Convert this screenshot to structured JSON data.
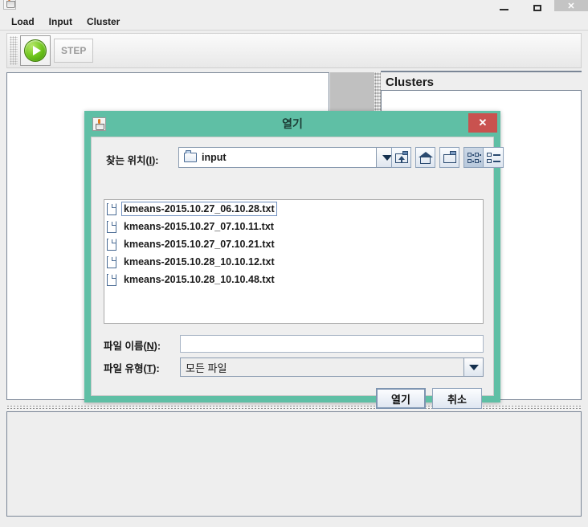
{
  "window": {
    "title": "",
    "controls": {
      "minimize": "–",
      "maximize": "☐",
      "close": "✕"
    },
    "app_icon": "java-coffee-cup-icon"
  },
  "menubar": {
    "items": [
      {
        "label": "Load"
      },
      {
        "label": "Input"
      },
      {
        "label": "Cluster"
      }
    ]
  },
  "toolbar": {
    "run_icon": "green-play-button-icon",
    "step_label": "STEP"
  },
  "main": {
    "clusters_panel": {
      "title": "Clusters"
    }
  },
  "dialog": {
    "title": "열기",
    "close_label": "✕",
    "titlebar_color": "#5fbfa5",
    "close_button_color": "#c9524f",
    "lookin": {
      "label_prefix": "찾는 위치(",
      "label_mnemonic": "I",
      "label_suffix": "):",
      "value": "input",
      "icon": "folder-icon"
    },
    "nav_buttons": [
      {
        "name": "up-one-level",
        "icon": "up-one-level-icon",
        "pressed": false
      },
      {
        "name": "home",
        "icon": "home-icon",
        "pressed": false
      },
      {
        "name": "create-new-folder",
        "icon": "new-folder-icon",
        "pressed": false
      },
      {
        "name": "tile-view",
        "icon": "tile-view-icon",
        "pressed": true
      },
      {
        "name": "details-view",
        "icon": "details-view-icon",
        "pressed": false
      }
    ],
    "files": [
      {
        "name": "kmeans-2015.10.27_06.10.28.txt",
        "focused": true
      },
      {
        "name": "kmeans-2015.10.27_07.10.11.txt",
        "focused": false
      },
      {
        "name": "kmeans-2015.10.27_07.10.21.txt",
        "focused": false
      },
      {
        "name": "kmeans-2015.10.28_10.10.12.txt",
        "focused": false
      },
      {
        "name": "kmeans-2015.10.28_10.10.48.txt",
        "focused": false
      }
    ],
    "filename_field": {
      "label_prefix": "파일 이름(",
      "label_mnemonic": "N",
      "label_suffix": "):",
      "value": "",
      "placeholder": ""
    },
    "filetype_field": {
      "label_prefix": "파일 유형(",
      "label_mnemonic": "T",
      "label_suffix": "):",
      "value": "모든 파일"
    },
    "buttons": {
      "open": "열기",
      "cancel": "취소"
    }
  }
}
